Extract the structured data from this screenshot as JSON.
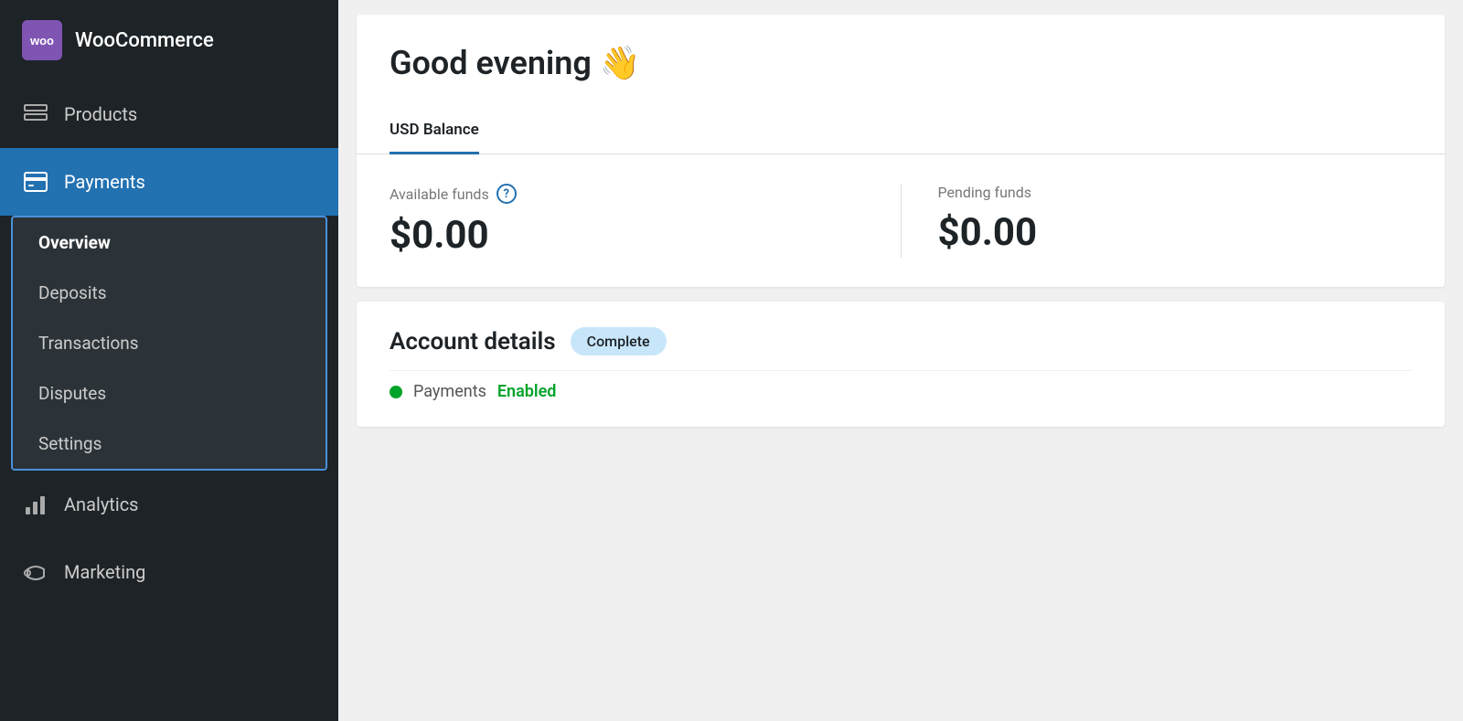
{
  "sidebar": {
    "logo": {
      "icon_label": "woo",
      "label": "WooCommerce"
    },
    "items": [
      {
        "id": "products",
        "label": "Products",
        "icon": "products"
      },
      {
        "id": "payments",
        "label": "Payments",
        "icon": "payments",
        "active": true
      },
      {
        "id": "analytics",
        "label": "Analytics",
        "icon": "analytics"
      },
      {
        "id": "marketing",
        "label": "Marketing",
        "icon": "marketing"
      }
    ],
    "payments_submenu": [
      {
        "id": "overview",
        "label": "Overview",
        "active": true
      },
      {
        "id": "deposits",
        "label": "Deposits"
      },
      {
        "id": "transactions",
        "label": "Transactions"
      },
      {
        "id": "disputes",
        "label": "Disputes"
      },
      {
        "id": "settings",
        "label": "Settings"
      }
    ]
  },
  "main": {
    "greeting": "Good evening 👋",
    "tabs": [
      {
        "id": "usd-balance",
        "label": "USD Balance",
        "active": true
      }
    ],
    "available_funds_label": "Available funds",
    "available_funds_amount": "$0.00",
    "pending_funds_label": "Pending funds",
    "pending_funds_amount": "$0.00",
    "account_details_title": "Account details",
    "account_badge": "Complete",
    "account_row_label": "Payments",
    "account_row_status": "Enabled"
  }
}
